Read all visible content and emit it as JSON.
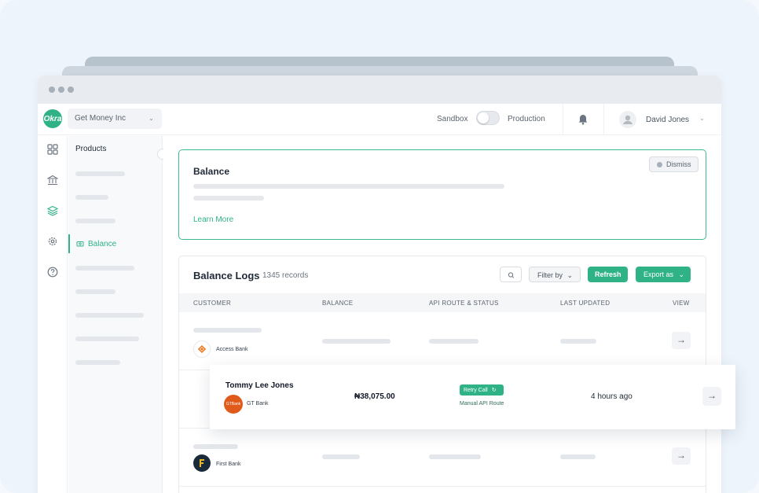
{
  "org": {
    "name": "Get Money Inc",
    "logo_text": "Okra"
  },
  "env": {
    "sandbox": "Sandbox",
    "production": "Production"
  },
  "user": {
    "name": "David Jones"
  },
  "sidebar": {
    "title": "Products",
    "active_item": "Balance"
  },
  "info_card": {
    "title": "Balance",
    "link": "Learn More",
    "dismiss": "Dismiss"
  },
  "logs": {
    "title": "Balance Logs",
    "count": "1345 records",
    "filter_label": "Filter by",
    "refresh_label": "Refresh",
    "export_label": "Export as",
    "columns": [
      "CUSTOMER",
      "BALANCE",
      "API ROUTE & STATUS",
      "LAST UPDATED",
      "VIEW"
    ],
    "rows": [
      {
        "bank": "Access Bank"
      },
      {
        "bank": "First Bank"
      }
    ],
    "highlight": {
      "customer": "Tommy Lee Jones",
      "bank": "GT Bank",
      "bank_logo_text": "GTBank",
      "balance": "₦38,075.00",
      "status": "Retry Call",
      "route": "Manual API Route",
      "updated": "4 hours ago"
    }
  },
  "colors": {
    "accent": "#2fb386",
    "background": "#eef4fb"
  }
}
